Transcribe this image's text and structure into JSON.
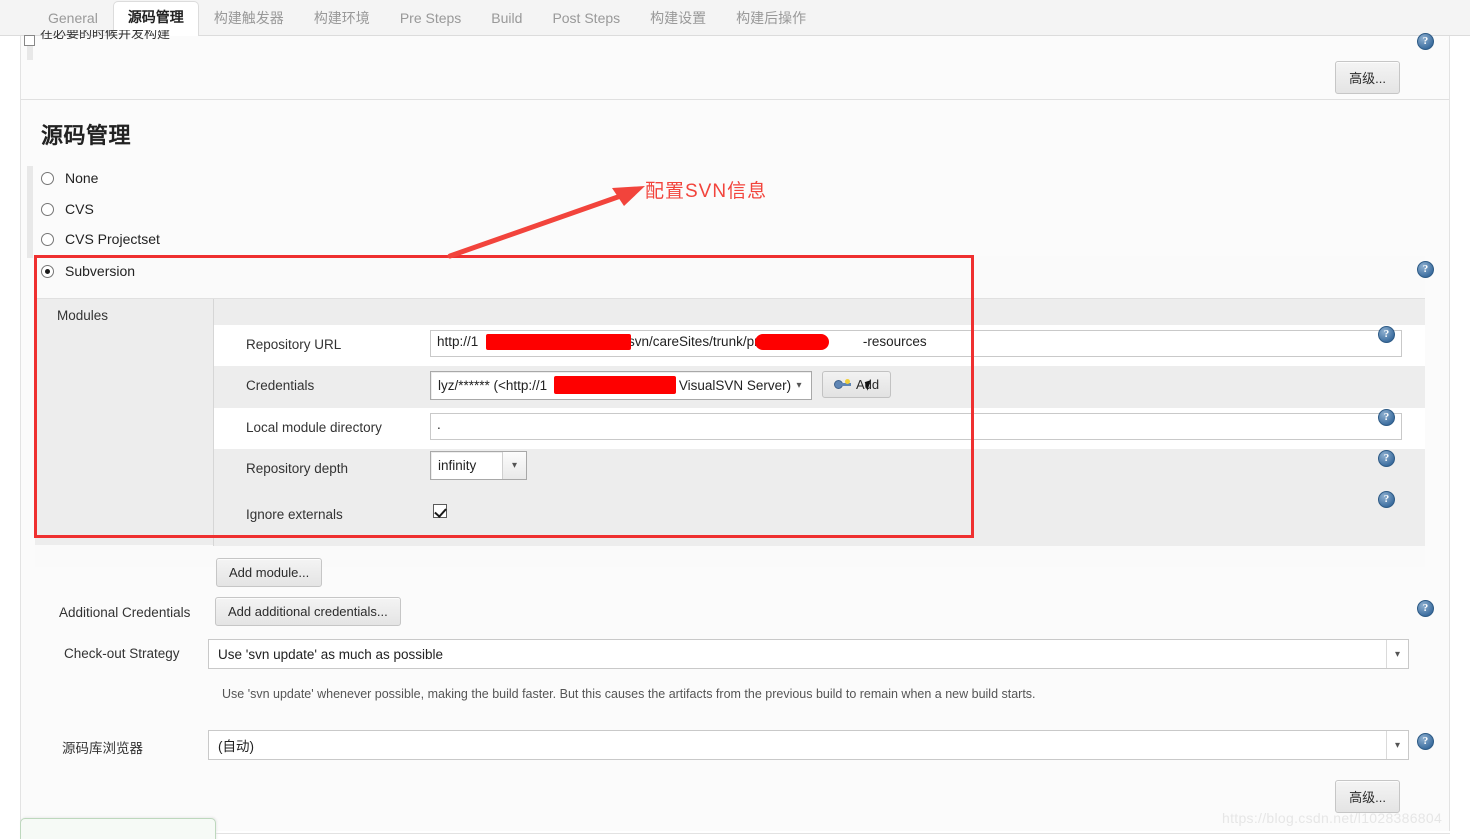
{
  "tabs": [
    {
      "label": "General",
      "active": false
    },
    {
      "label": "源码管理",
      "active": true
    },
    {
      "label": "构建触发器",
      "active": false
    },
    {
      "label": "构建环境",
      "active": false
    },
    {
      "label": "Pre Steps",
      "active": false
    },
    {
      "label": "Build",
      "active": false
    },
    {
      "label": "Post Steps",
      "active": false
    },
    {
      "label": "构建设置",
      "active": false
    },
    {
      "label": "构建后操作",
      "active": false
    }
  ],
  "top_cutoff_row": {
    "label": "在必要的时候并发构建",
    "checked": false
  },
  "advanced_button_top": "高级...",
  "advanced_button_bottom": "高级...",
  "section": {
    "heading": "源码管理",
    "scm_options": [
      {
        "label": "None",
        "selected": false
      },
      {
        "label": "CVS",
        "selected": false
      },
      {
        "label": "CVS Projectset",
        "selected": false
      },
      {
        "label": "Subversion",
        "selected": true
      }
    ]
  },
  "annotation": {
    "text": "配置SVN信息",
    "color": "#f2443c",
    "box_color": "#ef3030"
  },
  "subversion": {
    "modules_label": "Modules",
    "fields": {
      "repository_url": {
        "label": "Repository URL",
        "value_prefix": "http://1",
        "value_middle": "/svn/careSites/trunk/project/",
        "value_suffix": "-resources"
      },
      "credentials": {
        "label": "Credentials",
        "value_prefix": "lyz/****** (<http://1",
        "value_suffix": "> VisualSVN Server)",
        "add_button": "Add"
      },
      "local_module_directory": {
        "label": "Local module directory",
        "value": "."
      },
      "repository_depth": {
        "label": "Repository depth",
        "value": "infinity"
      },
      "ignore_externals": {
        "label": "Ignore externals",
        "checked": true
      }
    },
    "add_module_button": "Add module...",
    "additional_credentials": {
      "label": "Additional Credentials",
      "button": "Add additional credentials..."
    },
    "checkout_strategy": {
      "label": "Check-out Strategy",
      "value": "Use 'svn update' as much as possible",
      "description": "Use 'svn update' whenever possible, making the build faster. But this causes the artifacts from the previous build to remain when a new build starts."
    },
    "repository_browser": {
      "label": "源码库浏览器",
      "value": "(自动)"
    }
  },
  "help_icon_glyph": "?",
  "watermark": "https://blog.csdn.net/l1028386804"
}
